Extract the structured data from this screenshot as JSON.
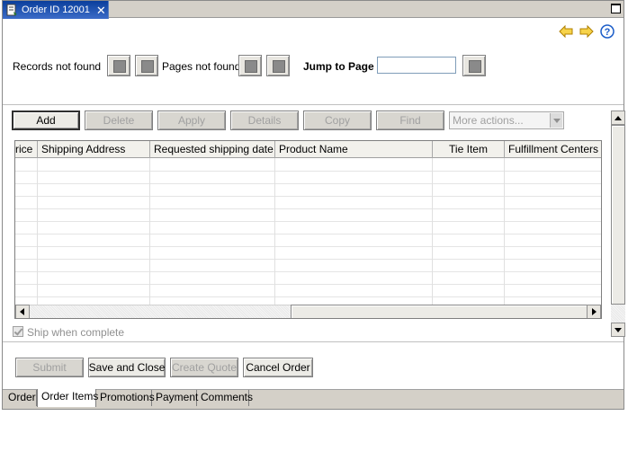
{
  "window": {
    "tab_title": "Order ID 12001"
  },
  "paging": {
    "records_label": "Records not found",
    "pages_label": "Pages not found",
    "jump_label": "Jump to Page",
    "jump_value": ""
  },
  "actions": {
    "add": "Add",
    "delete": "Delete",
    "apply": "Apply",
    "details": "Details",
    "copy": "Copy",
    "find": "Find",
    "more_actions": "More actions..."
  },
  "table": {
    "columns": [
      "rice",
      "Shipping Address",
      "Requested shipping date",
      "Product Name",
      "Tie Item",
      "Fulfillment Centers"
    ]
  },
  "ship_when_complete": "Ship when complete",
  "footer_buttons": {
    "submit": "Submit",
    "save_close": "Save and Close",
    "create_quote": "Create Quote",
    "cancel_order": "Cancel Order"
  },
  "bottom_tabs": [
    "Order",
    "Order Items",
    "Promotions",
    "Payment",
    "Comments"
  ],
  "colors": {
    "title_gradient_start": "#0a3f9c",
    "nav_arrow": "#e0a800",
    "help": "#1a5cc8"
  }
}
